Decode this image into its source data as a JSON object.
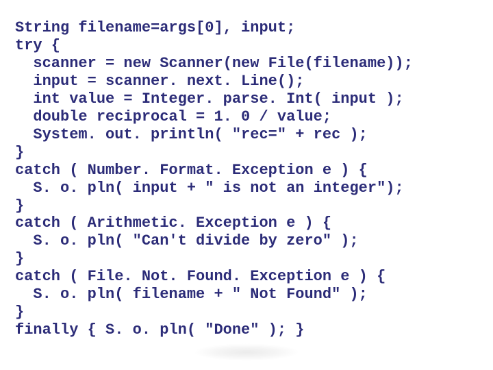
{
  "code": {
    "lines": [
      "String filename=args[0], input;",
      "try {",
      "  scanner = new Scanner(new File(filename));",
      "  input = scanner. next. Line();",
      "  int value = Integer. parse. Int( input );",
      "  double reciprocal = 1. 0 / value;",
      "  System. out. println( \"rec=\" + rec );",
      "}",
      "catch ( Number. Format. Exception e ) {",
      "  S. o. pln( input + \" is not an integer\");",
      "}",
      "catch ( Arithmetic. Exception e ) {",
      "  S. o. pln( \"Can't divide by zero\" );",
      "}",
      "catch ( File. Not. Found. Exception e ) {",
      "  S. o. pln( filename + \" Not Found\" );",
      "}",
      "finally { S. o. pln( \"Done\" ); }"
    ]
  }
}
